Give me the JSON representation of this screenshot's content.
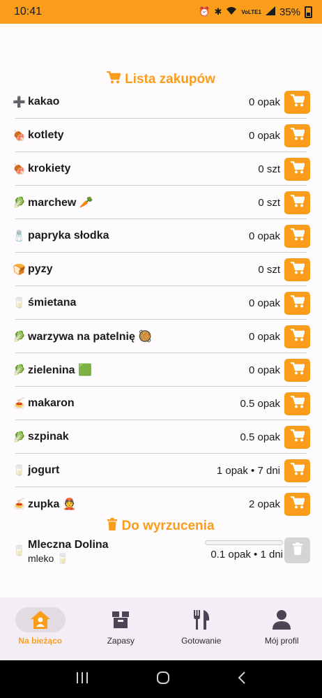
{
  "status_bar": {
    "time": "10:41",
    "signal_text": "VoLTE1",
    "battery": "35%"
  },
  "shopping": {
    "title": "Lista zakupów",
    "items": [
      {
        "icon": "➕",
        "name": "kakao",
        "qty": "0 opak"
      },
      {
        "icon": "🍖",
        "name": "kotlety",
        "qty": "0 opak"
      },
      {
        "icon": "🍖",
        "name": "krokiety",
        "qty": "0 szt"
      },
      {
        "icon": "🥬",
        "name": "marchew 🥕",
        "qty": "0 szt"
      },
      {
        "icon": "🧂",
        "name": "papryka słodka",
        "qty": "0 opak"
      },
      {
        "icon": "🍞",
        "name": "pyzy",
        "qty": "0 szt"
      },
      {
        "icon": "🥛",
        "name": "śmietana",
        "qty": "0 opak"
      },
      {
        "icon": "🥬",
        "name": "warzywa na patelnię 🥘",
        "qty": "0 opak"
      },
      {
        "icon": "🥬",
        "name": "zielenina 🟩",
        "qty": "0 opak"
      },
      {
        "icon": "🍝",
        "name": "makaron",
        "qty": "0.5 opak"
      },
      {
        "icon": "🥬",
        "name": "szpinak",
        "qty": "0.5 opak"
      },
      {
        "icon": "🥛",
        "name": "jogurt",
        "qty": "1 opak • 7 dni"
      },
      {
        "icon": "🍝",
        "name": "zupka 👲",
        "qty": "2 opak"
      }
    ]
  },
  "trash": {
    "title": "Do wyrzucenia",
    "items": [
      {
        "icon": "🥛",
        "name": "Mleczna Dolina",
        "sub": "mleko 🥛",
        "qty": "0.1 opak • 1 dni",
        "freshness": 0.0
      }
    ]
  },
  "nav": {
    "items": [
      {
        "label": "Na bieżąco",
        "icon": "home-icon",
        "active": true
      },
      {
        "label": "Zapasy",
        "icon": "box-icon",
        "active": false
      },
      {
        "label": "Gotowanie",
        "icon": "cutlery-icon",
        "active": false
      },
      {
        "label": "Mój profil",
        "icon": "person-icon",
        "active": false
      }
    ]
  },
  "colors": {
    "accent": "#f99d1b",
    "disabled": "#d4d4d4",
    "nav_bg": "#f3eef5"
  }
}
